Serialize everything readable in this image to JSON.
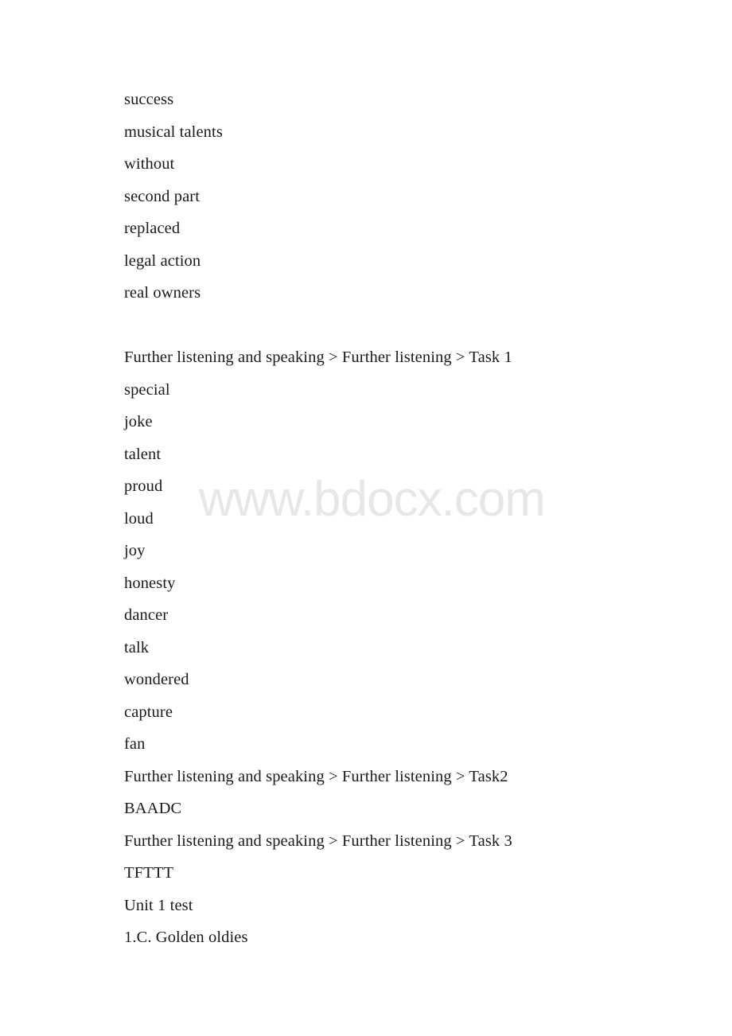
{
  "page": {
    "background_color": "#ffffff",
    "text_color": "#1a1a1a"
  },
  "watermark": {
    "text": "www.bdocx.com",
    "color": "#e7e7e7"
  },
  "content": {
    "lines": [
      {
        "id": "line-1",
        "type": "answer",
        "text": "success"
      },
      {
        "id": "line-2",
        "type": "answer",
        "text": "musical talents"
      },
      {
        "id": "line-3",
        "type": "answer",
        "text": "without"
      },
      {
        "id": "line-4",
        "type": "answer",
        "text": "second part"
      },
      {
        "id": "line-5",
        "type": "answer",
        "text": "replaced"
      },
      {
        "id": "line-6",
        "type": "answer",
        "text": "legal action"
      },
      {
        "id": "line-7",
        "type": "answer",
        "text": "real owners"
      },
      {
        "id": "line-8",
        "type": "blank",
        "text": ""
      },
      {
        "id": "line-9",
        "type": "heading",
        "text": "Further listening and speaking > Further listening > Task 1"
      },
      {
        "id": "line-10",
        "type": "answer",
        "text": "special"
      },
      {
        "id": "line-11",
        "type": "answer",
        "text": "joke"
      },
      {
        "id": "line-12",
        "type": "answer",
        "text": "talent"
      },
      {
        "id": "line-13",
        "type": "answer",
        "text": "proud"
      },
      {
        "id": "line-14",
        "type": "answer",
        "text": "loud"
      },
      {
        "id": "line-15",
        "type": "answer",
        "text": "joy"
      },
      {
        "id": "line-16",
        "type": "answer",
        "text": "honesty"
      },
      {
        "id": "line-17",
        "type": "answer",
        "text": "dancer"
      },
      {
        "id": "line-18",
        "type": "answer",
        "text": "talk"
      },
      {
        "id": "line-19",
        "type": "answer",
        "text": "wondered"
      },
      {
        "id": "line-20",
        "type": "answer",
        "text": "capture"
      },
      {
        "id": "line-21",
        "type": "answer",
        "text": "fan"
      },
      {
        "id": "line-22",
        "type": "heading",
        "text": "Further listening and speaking > Further listening > Task2"
      },
      {
        "id": "line-23",
        "type": "answer",
        "text": "BAADC"
      },
      {
        "id": "line-24",
        "type": "heading",
        "text": "Further listening and speaking > Further listening > Task 3"
      },
      {
        "id": "line-25",
        "type": "answer",
        "text": "TFTTT"
      },
      {
        "id": "line-26",
        "type": "heading",
        "text": "Unit 1 test"
      },
      {
        "id": "line-27",
        "type": "answer",
        "text": "1.C. Golden oldies"
      }
    ]
  }
}
